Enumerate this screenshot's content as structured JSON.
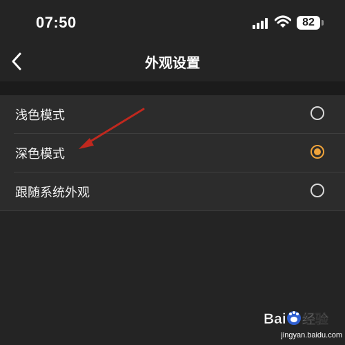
{
  "status_bar": {
    "time": "07:50",
    "battery": "82",
    "icons": [
      "cellular-signal-icon",
      "wifi-icon",
      "battery-icon"
    ]
  },
  "nav": {
    "back_icon": "chevron-left-icon",
    "title": "外观设置"
  },
  "options": [
    {
      "label": "浅色模式",
      "selected": false
    },
    {
      "label": "深色模式",
      "selected": true
    },
    {
      "label": "跟随系统外观",
      "selected": false
    }
  ],
  "annotation": {
    "type": "arrow",
    "color": "#c0281e",
    "points_to": "深色模式"
  },
  "watermark": {
    "brand": "Baidu经验",
    "url": "jingyan.baidu.com"
  },
  "colors": {
    "background": "#242424",
    "list_background": "#2c2c2c",
    "accent": "#f0a33a",
    "text": "#ffffff"
  }
}
